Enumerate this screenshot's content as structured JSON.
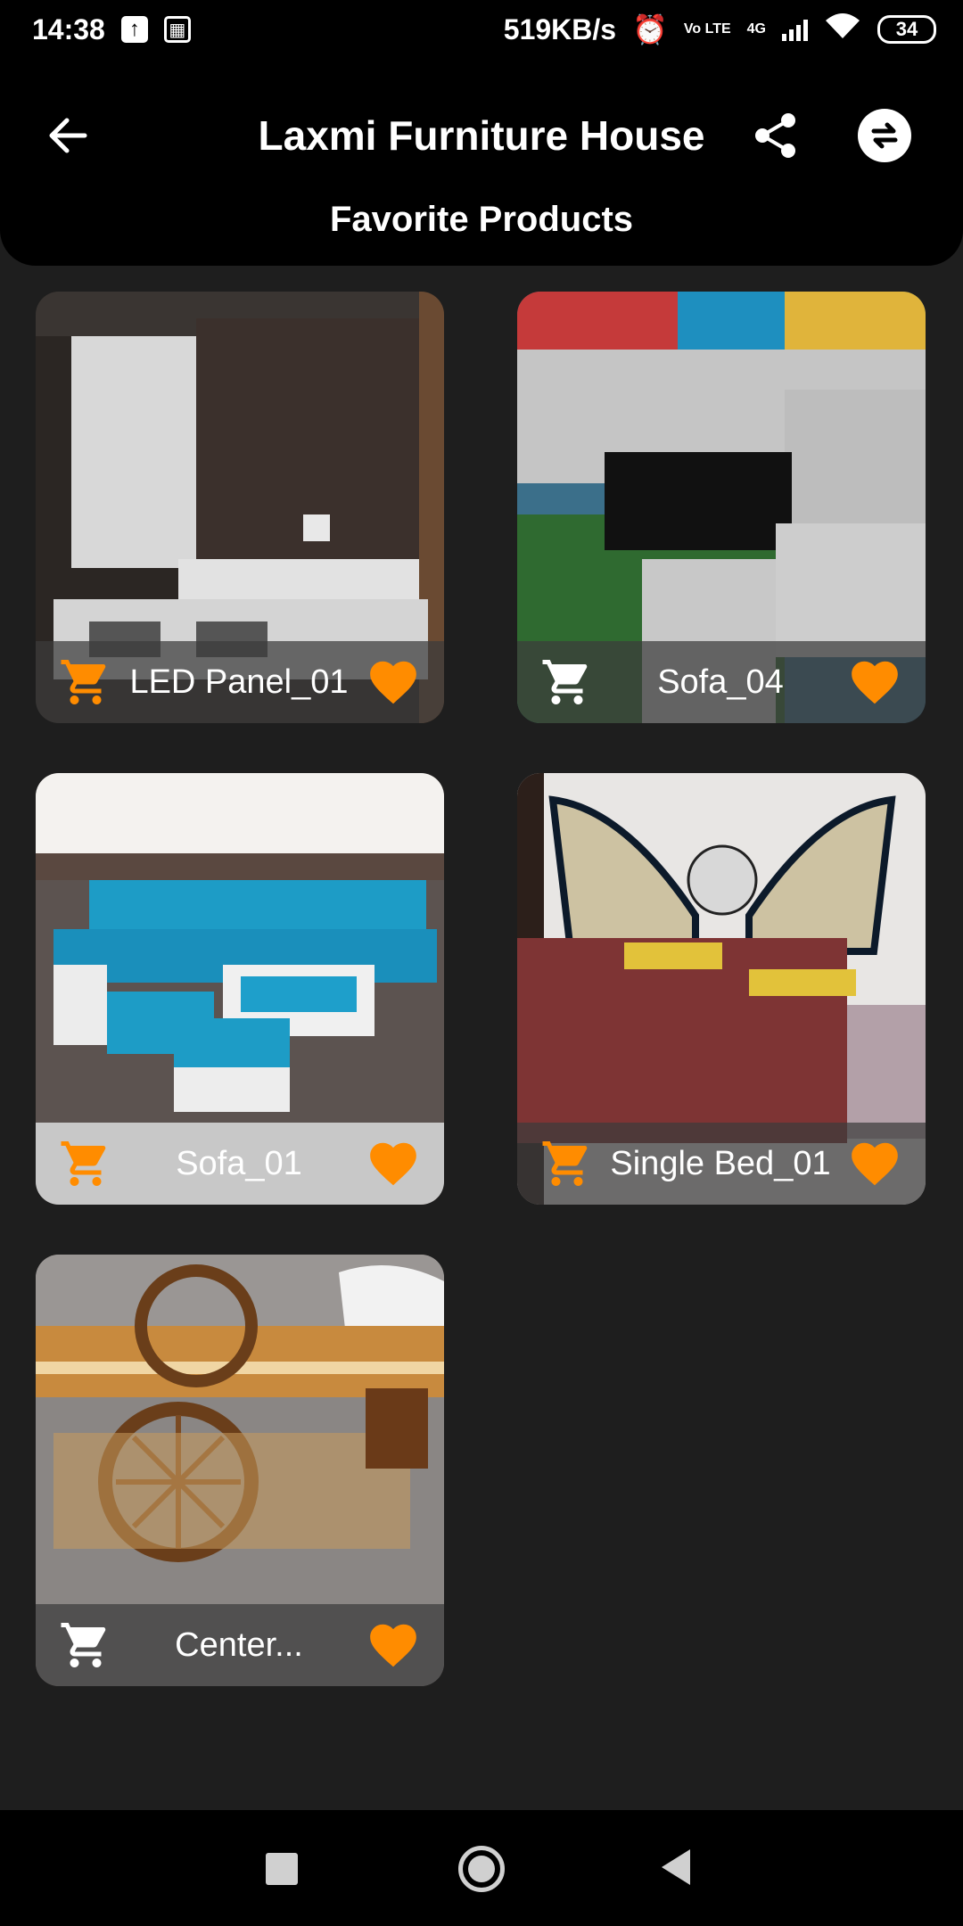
{
  "status_bar": {
    "time": "14:38",
    "network_speed": "519KB/s",
    "volte": "Vo LTE",
    "network_type": "4G",
    "battery": "34"
  },
  "header": {
    "title": "Laxmi Furniture House",
    "subtitle": "Favorite Products"
  },
  "products": [
    {
      "name": "LED Panel_01",
      "favorite": true
    },
    {
      "name": "Sofa_04",
      "favorite": true
    },
    {
      "name": "Sofa_01",
      "favorite": true
    },
    {
      "name": "Single Bed_01",
      "favorite": true
    },
    {
      "name": "Center...",
      "favorite": true
    }
  ],
  "colors": {
    "accent": "#ff8c00",
    "background": "#1e1e1e",
    "header": "#000000"
  }
}
